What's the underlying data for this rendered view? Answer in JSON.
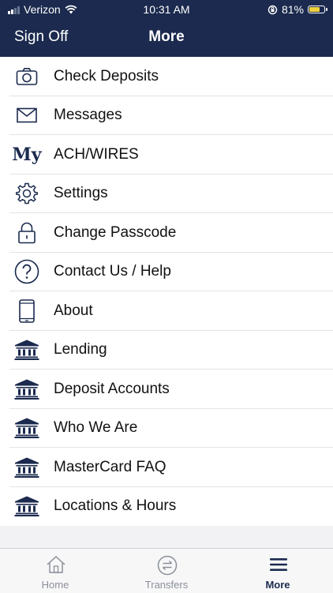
{
  "status_bar": {
    "carrier": "Verizon",
    "time": "10:31 AM",
    "battery": "81%",
    "battery_level": 0.81
  },
  "header": {
    "left_button": "Sign Off",
    "title": "More"
  },
  "menu": {
    "items": [
      {
        "label": "Check Deposits",
        "icon": "camera-icon"
      },
      {
        "label": "Messages",
        "icon": "envelope-icon"
      },
      {
        "label": "ACH/WIRES",
        "icon": "my-logo-icon",
        "icon_text": "My"
      },
      {
        "label": "Settings",
        "icon": "gear-icon"
      },
      {
        "label": "Change Passcode",
        "icon": "lock-icon"
      },
      {
        "label": "Contact Us / Help",
        "icon": "help-icon"
      },
      {
        "label": "About",
        "icon": "phone-icon"
      },
      {
        "label": "Lending",
        "icon": "bank-icon"
      },
      {
        "label": "Deposit Accounts",
        "icon": "bank-icon"
      },
      {
        "label": "Who We Are",
        "icon": "bank-icon"
      },
      {
        "label": "MasterCard FAQ",
        "icon": "bank-icon"
      },
      {
        "label": "Locations & Hours",
        "icon": "bank-icon"
      }
    ]
  },
  "tab_bar": {
    "tabs": [
      {
        "label": "Home",
        "icon": "home-icon"
      },
      {
        "label": "Transfers",
        "icon": "transfers-icon"
      },
      {
        "label": "More",
        "icon": "menu-icon"
      }
    ],
    "active": "More"
  },
  "colors": {
    "brand": "#1b2a4e",
    "icon": "#1b2a4e",
    "tab_inactive": "#8a8f98"
  }
}
